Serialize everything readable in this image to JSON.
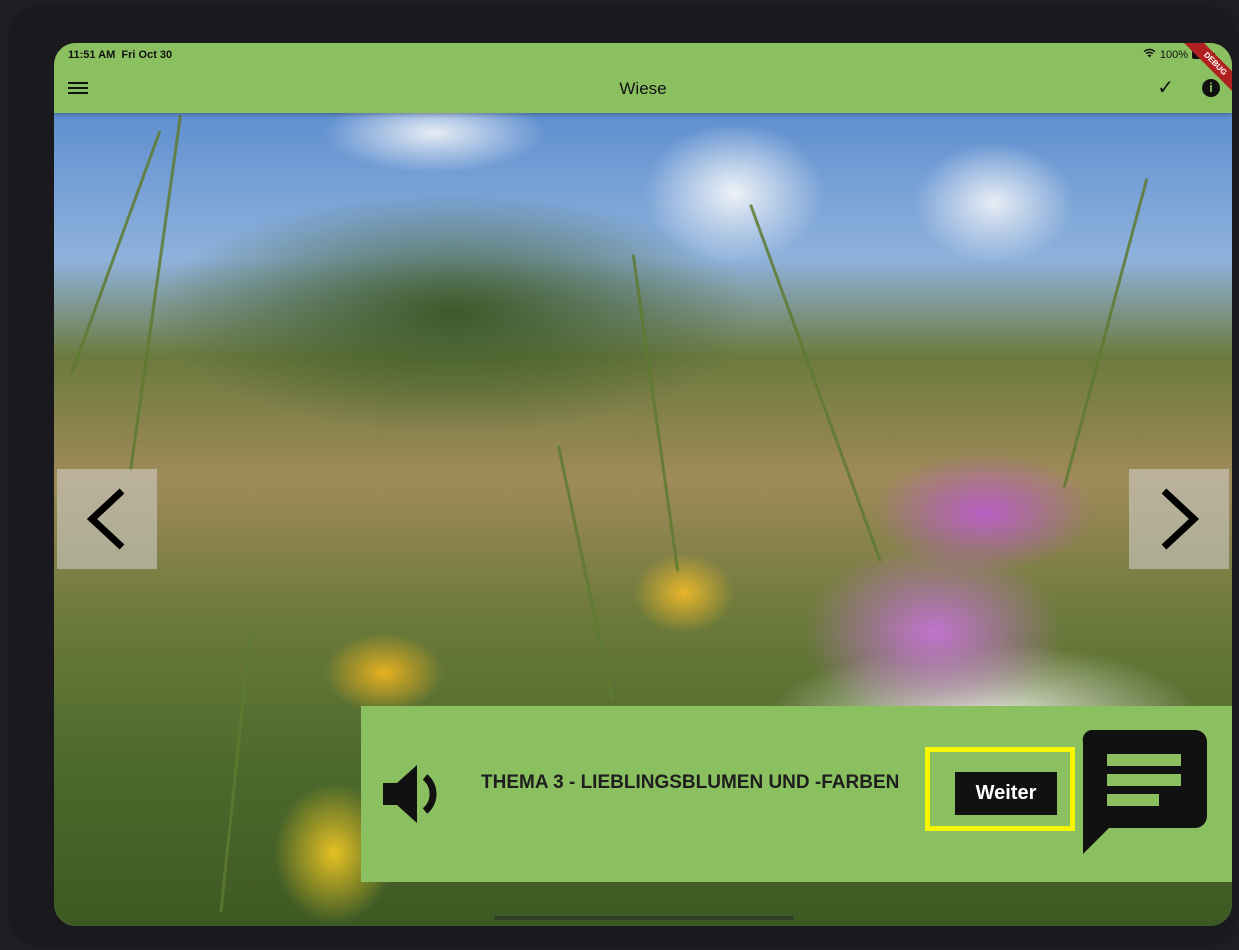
{
  "status_bar": {
    "time": "11:51 AM",
    "date": "Fri Oct 30",
    "battery": "100%",
    "icons": [
      "wifi-icon",
      "battery-icon"
    ]
  },
  "app_bar": {
    "title": "Wiese",
    "menu_icon": "hamburger-menu-icon",
    "check_icon": "checkmark-icon",
    "info_icon": "info-icon",
    "info_glyph": "i",
    "check_glyph": "✓",
    "debug_banner": "DEBUG",
    "color": "#8bc060"
  },
  "navigation": {
    "prev_icon": "chevron-left-icon",
    "next_icon": "chevron-right-icon"
  },
  "panel": {
    "title": "THEMA 3 - LIEBLINGSBLUMEN UND -FARBEN",
    "speaker_icon": "speaker-icon",
    "chat_icon": "chat-bubble-icon",
    "next_button_label": "Weiter",
    "highlight_color": "#f7f500"
  }
}
